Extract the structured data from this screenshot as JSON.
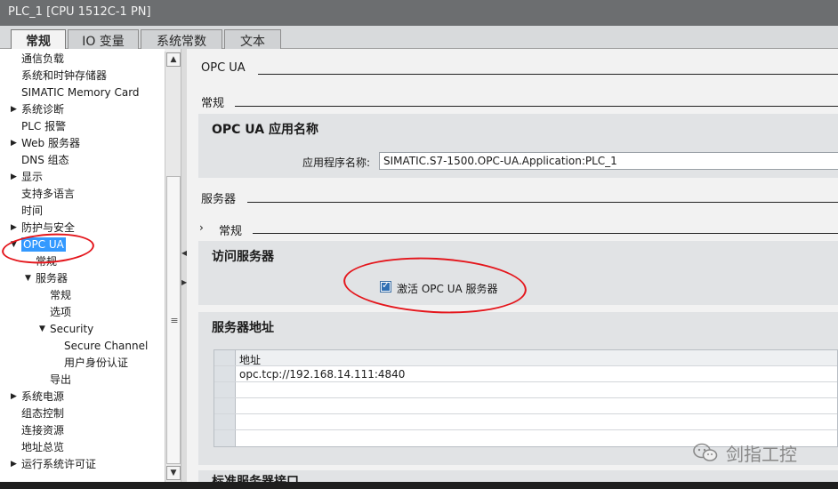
{
  "window": {
    "title": "PLC_1 [CPU 1512C-1 PN]"
  },
  "tabs": [
    {
      "label": "常规",
      "active": true
    },
    {
      "label": "IO 变量",
      "active": false
    },
    {
      "label": "系统常数",
      "active": false
    },
    {
      "label": "文本",
      "active": false
    }
  ],
  "tree": [
    {
      "label": "通信负载"
    },
    {
      "label": "系统和时钟存储器"
    },
    {
      "label": "SIMATIC Memory Card"
    },
    {
      "label": "系统诊断",
      "expander": "collapsed"
    },
    {
      "label": "PLC 报警"
    },
    {
      "label": "Web 服务器",
      "expander": "collapsed"
    },
    {
      "label": "DNS 组态"
    },
    {
      "label": "显示",
      "expander": "collapsed"
    },
    {
      "label": "支持多语言"
    },
    {
      "label": "时间"
    },
    {
      "label": "防护与安全",
      "expander": "collapsed"
    },
    {
      "label": "OPC UA",
      "expander": "expanded",
      "selected": true
    },
    {
      "label": "常规"
    },
    {
      "label": "服务器",
      "expander": "expanded"
    },
    {
      "label": "常规"
    },
    {
      "label": "选项"
    },
    {
      "label": "Security",
      "expander": "expanded"
    },
    {
      "label": "Secure Channel"
    },
    {
      "label": "用户身份认证"
    },
    {
      "label": "导出"
    },
    {
      "label": "系统电源",
      "expander": "collapsed"
    },
    {
      "label": "组态控制"
    },
    {
      "label": "连接资源"
    },
    {
      "label": "地址总览"
    },
    {
      "label": "运行系统许可证",
      "expander": "collapsed"
    }
  ],
  "content": {
    "opcua_heading": "OPC UA",
    "general_heading": "常规",
    "app_name_section": {
      "title": "OPC UA 应用名称",
      "field_label": "应用程序名称:",
      "field_value": "SIMATIC.S7-1500.OPC-UA.Application:PLC_1"
    },
    "server_heading": "服务器",
    "server_general_heading": "常规",
    "access_section": {
      "title": "访问服务器",
      "checkbox_label": "激活 OPC UA 服务器",
      "checkbox_checked": true
    },
    "address_section": {
      "title": "服务器地址",
      "column_header": "地址",
      "rows": [
        "opc.tcp://192.168.14.111:4840",
        "",
        "",
        "",
        ""
      ]
    },
    "next_section_title": "标准服务器接口"
  },
  "watermark": {
    "text": "剑指工控"
  },
  "colors": {
    "title_bar": "#6c6e70",
    "selection": "#3399ff",
    "checkbox": "#2f6fb3",
    "annotation": "#e4161c"
  }
}
